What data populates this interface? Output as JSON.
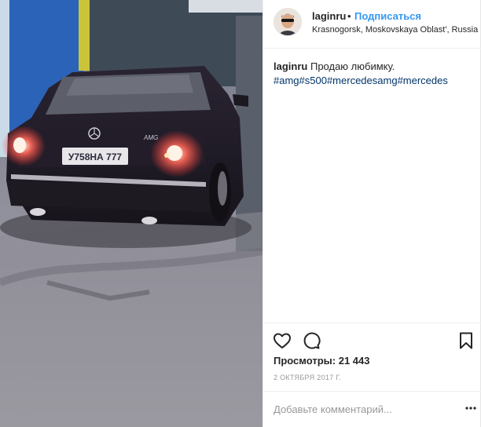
{
  "post": {
    "username": "laginru",
    "separator": "•",
    "follow_label": "Подписаться",
    "location": "Krasnogorsk, Moskovskaya Oblast', Russia",
    "caption": {
      "username": "laginru",
      "text": "Продаю любимку.",
      "hashtags": [
        "#amg",
        "#s500",
        "#mercedesamg",
        "#mercedes"
      ]
    },
    "views_label": "Просмотры:",
    "views_count": "21 443",
    "date": "2 ОКТЯБРЯ 2017 Г.",
    "comment_placeholder": "Добавьте комментарий...",
    "media": {
      "license_plate": "У758НА 777",
      "badge": "AMG"
    },
    "icons": {
      "like": "heart-icon",
      "comment": "comment-icon",
      "save": "bookmark-icon",
      "options": "more-options-icon"
    },
    "colors": {
      "link_blue": "#3897f0",
      "hashtag": "#003569",
      "text": "#262626",
      "muted": "#999999"
    }
  }
}
